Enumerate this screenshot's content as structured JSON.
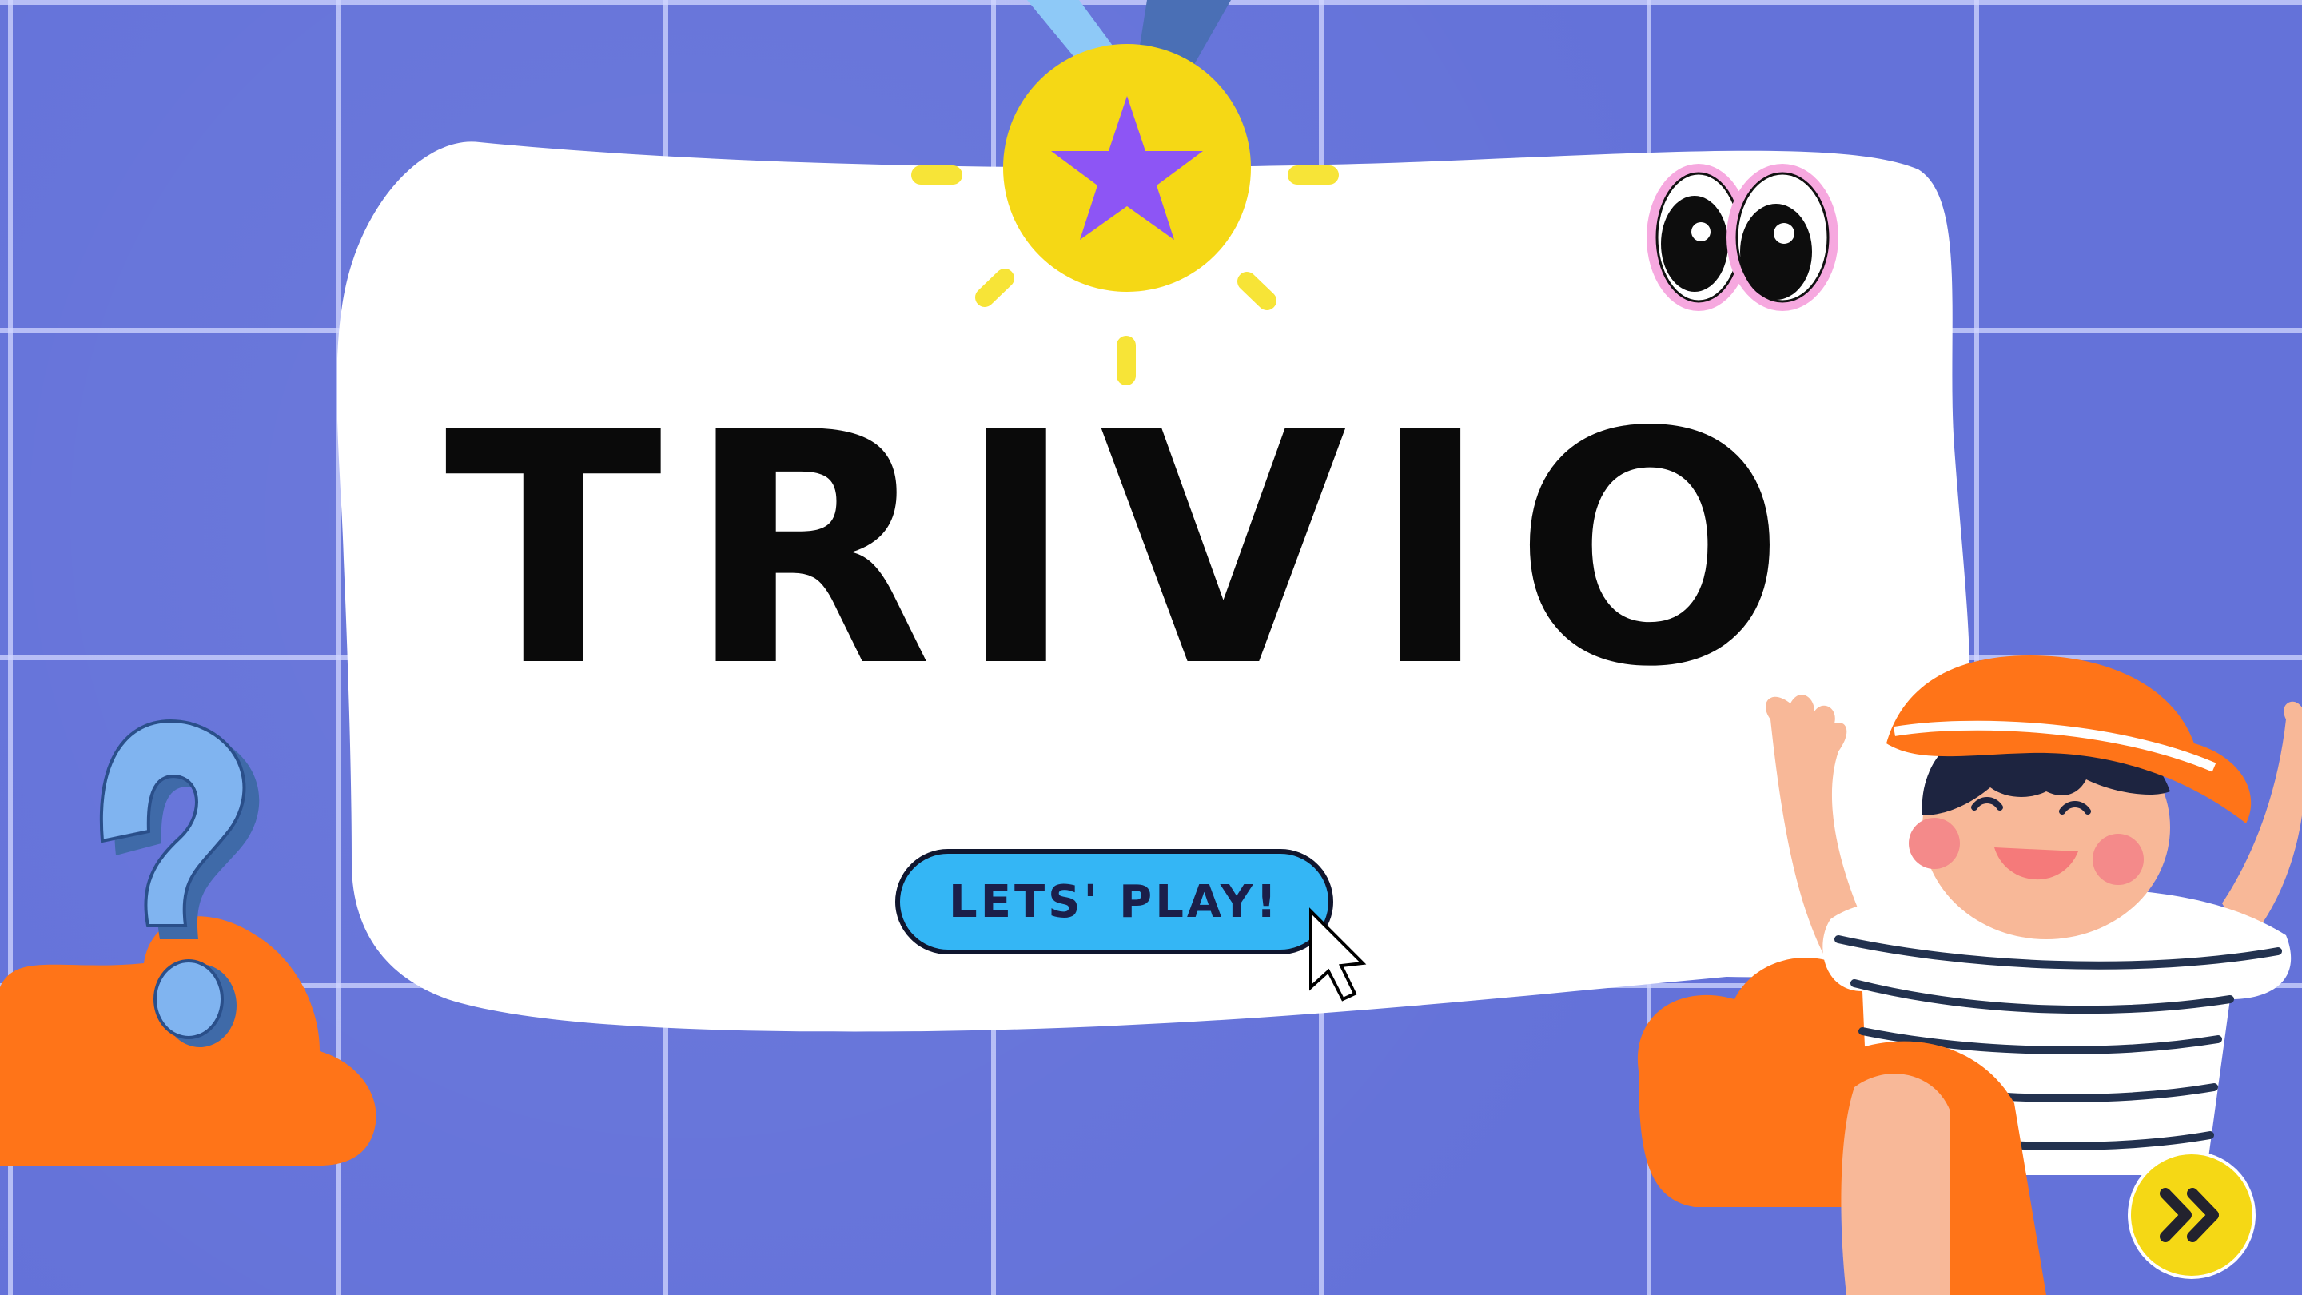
{
  "slide": {
    "title": "TRIVIO",
    "play_button_label": "LETS' PLAY!"
  },
  "icons": {
    "medal": "medal-star-icon",
    "eyes": "googly-eyes-icon",
    "question": "question-mark-icon",
    "cursor": "mouse-pointer-icon",
    "next": "double-chevron-right-icon"
  },
  "colors": {
    "background": "#6472d9",
    "card": "#ffffff",
    "button": "#34b6f5",
    "medal": "#f5d815",
    "star": "#8d55f5",
    "cloud": "#ff7418",
    "question": "#80b4f0",
    "next_button": "#f5d815"
  }
}
